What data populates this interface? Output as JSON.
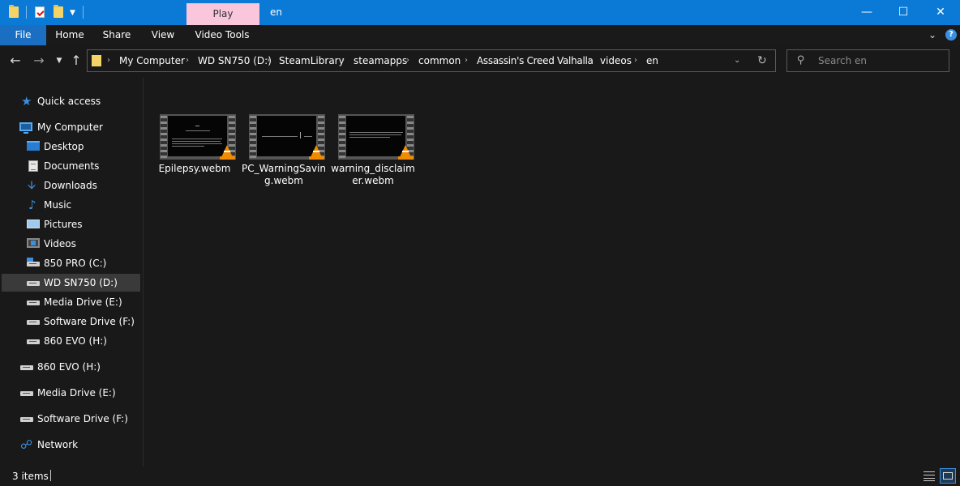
{
  "window": {
    "title": "en",
    "contextual_tab": "Play",
    "controls": [
      "minimize",
      "maximize",
      "close"
    ]
  },
  "ribbon": {
    "tabs": [
      {
        "label": "File"
      },
      {
        "label": "Home"
      },
      {
        "label": "Share"
      },
      {
        "label": "View"
      },
      {
        "label": "Video Tools"
      }
    ]
  },
  "address": {
    "crumbs": [
      "My Computer",
      "WD SN750 (D:)",
      "SteamLibrary",
      "steamapps",
      "common",
      "Assassin's Creed Valhalla",
      "videos",
      "en"
    ]
  },
  "search": {
    "placeholder": "Search en"
  },
  "sidebar": {
    "items": [
      {
        "label": "Quick access",
        "icon": "star-icon"
      },
      {
        "label": "My Computer",
        "icon": "monitor-icon"
      },
      {
        "label": "Desktop",
        "icon": "desktop-folder-icon"
      },
      {
        "label": "Documents",
        "icon": "documents-icon"
      },
      {
        "label": "Downloads",
        "icon": "download-arrow-icon"
      },
      {
        "label": "Music",
        "icon": "music-note-icon"
      },
      {
        "label": "Pictures",
        "icon": "pictures-icon"
      },
      {
        "label": "Videos",
        "icon": "videos-icon"
      },
      {
        "label": "850 PRO (C:)",
        "icon": "system-drive-icon"
      },
      {
        "label": "WD SN750 (D:)",
        "icon": "drive-icon",
        "selected": true
      },
      {
        "label": "Media Drive (E:)",
        "icon": "drive-icon"
      },
      {
        "label": "Software Drive (F:)",
        "icon": "drive-icon"
      },
      {
        "label": "860 EVO (H:)",
        "icon": "drive-icon"
      },
      {
        "label": "860 EVO (H:)",
        "icon": "drive-icon"
      },
      {
        "label": "Media Drive (E:)",
        "icon": "drive-icon"
      },
      {
        "label": "Software Drive (F:)",
        "icon": "drive-icon"
      },
      {
        "label": "Network",
        "icon": "network-icon"
      }
    ]
  },
  "files": [
    {
      "name": "Epilepsy.webm",
      "icon": "vlc-cone-icon"
    },
    {
      "name": "PC_WarningSaving.webm",
      "icon": "vlc-cone-icon"
    },
    {
      "name": "warning_disclaimer.webm",
      "icon": "vlc-cone-icon"
    }
  ],
  "status": {
    "item_count": "3 items"
  },
  "colors": {
    "titlebar": "#0b7ad6",
    "file_tab": "#1a6fc2",
    "play_tab": "#f9c6dc",
    "background": "#191919",
    "selection": "#3a3a3a"
  }
}
